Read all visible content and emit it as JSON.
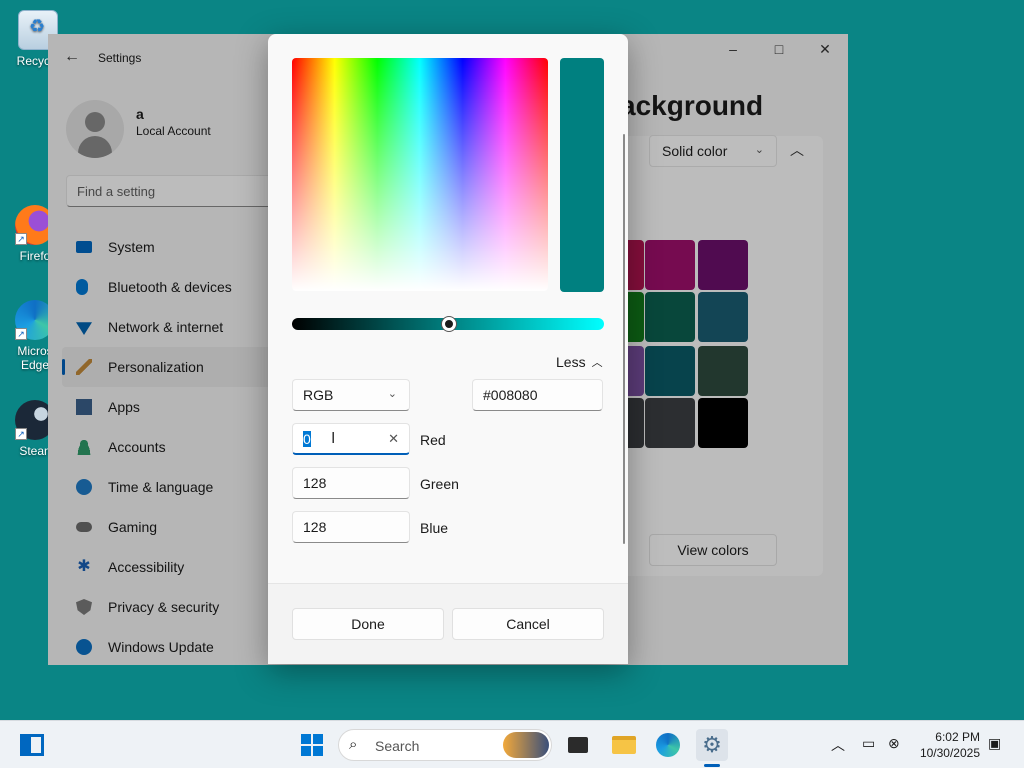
{
  "desktop": {
    "icons": [
      {
        "label": "Recycle"
      },
      {
        "label": "Firefo"
      },
      {
        "label": "Micros Edge"
      },
      {
        "label": "Stean"
      }
    ]
  },
  "window": {
    "title": "Settings",
    "controls": {
      "minimize": "–",
      "maximize": "□",
      "close": "✕"
    }
  },
  "user": {
    "name": "a",
    "account_type": "Local Account"
  },
  "search": {
    "placeholder": "Find a setting"
  },
  "sidebar": {
    "items": [
      {
        "label": "System",
        "icon": "monitor-icon",
        "color": "#0067c0"
      },
      {
        "label": "Bluetooth & devices",
        "icon": "bluetooth-icon",
        "color": "#0078d4"
      },
      {
        "label": "Network & internet",
        "icon": "wifi-icon",
        "color": "#0063b1"
      },
      {
        "label": "Personalization",
        "icon": "brush-icon",
        "color": "#c28a3a",
        "active": true
      },
      {
        "label": "Apps",
        "icon": "apps-icon",
        "color": "#3a5f8a"
      },
      {
        "label": "Accounts",
        "icon": "person-icon",
        "color": "#2f9b6a"
      },
      {
        "label": "Time & language",
        "icon": "globe-icon",
        "color": "#1f7ac4"
      },
      {
        "label": "Gaming",
        "icon": "gamepad-icon",
        "color": "#6b6b6b"
      },
      {
        "label": "Accessibility",
        "icon": "accessibility-icon",
        "color": "#1a5fb4"
      },
      {
        "label": "Privacy & security",
        "icon": "shield-icon",
        "color": "#7a7a7a"
      },
      {
        "label": "Windows Update",
        "icon": "update-icon",
        "color": "#0b6fc2"
      }
    ]
  },
  "main": {
    "heading": "ackground",
    "fill_dropdown": {
      "value": "Solid color"
    },
    "view_colors_label": "View colors",
    "swatches": [
      "#b0134f",
      "#9e0f6b",
      "#6b0f6b",
      "#117a1a",
      "#0b5f4f",
      "#1a5c72",
      "#7a4fa0",
      "#0a5a66",
      "#2e4a3e",
      "#3a3d40",
      "#3b3e42",
      "#000000"
    ]
  },
  "dialog": {
    "current_color": "#008080",
    "value_slider_level": 0.5,
    "less_label": "Less",
    "model_dropdown": {
      "value": "RGB"
    },
    "hex_value": "#008080",
    "channels": [
      {
        "label": "Red",
        "value": "0"
      },
      {
        "label": "Green",
        "value": "128"
      },
      {
        "label": "Blue",
        "value": "128"
      }
    ],
    "done_label": "Done",
    "cancel_label": "Cancel"
  },
  "taskbar": {
    "search_label": "Search",
    "time": "6:02 PM",
    "date": "10/30/2025",
    "accent": "#005fb8"
  }
}
